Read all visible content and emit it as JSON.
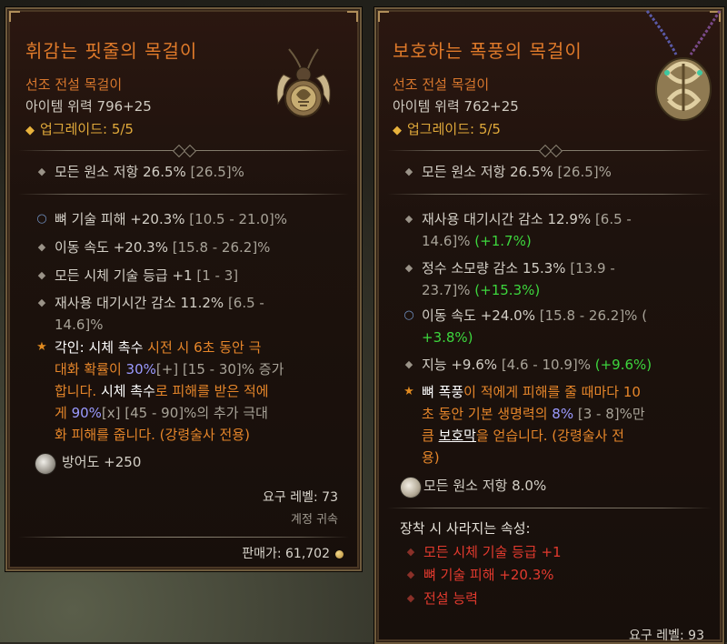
{
  "left": {
    "title": "휘감는 핏줄의 목걸이",
    "subtitle": "선조 전설 목걸이",
    "power": "아이템 위력 796+25",
    "upgrade": "업그레이드: 5/5",
    "implicit": {
      "text": "모든 원소 저항 26.5% ",
      "range": "[26.5]%"
    },
    "affixes": [
      {
        "text": "뼈 기술 피해 +20.3% ",
        "range": "[10.5 - 21.0]%"
      },
      {
        "text": "이동 속도 +20.3% ",
        "range": "[15.8 - 26.2]%"
      },
      {
        "text": "모든 시체 기술 등급 +1 ",
        "range": "[1 - 3]"
      },
      {
        "text": "재사용 대기시간 감소 11.2% ",
        "range": "[6.5 -",
        "range2": "14.6]%"
      }
    ],
    "aspect": {
      "l1a": "각인: ",
      "l1b": "시체 촉수",
      "l1c": " 시전 시 6초 동안 극",
      "l2a": "대화 확률이 ",
      "l2b": "30%",
      "l2c": "[+]",
      "l2d": " [15 - 30]% 증가",
      "l3a": "합니다. ",
      "l3b": "시체 촉수",
      "l3c": "로 피해를 받은 적에",
      "l4a": "게 ",
      "l4b": "90%",
      "l4c": "[x]",
      "l4d": " [45 - 90]%의 추가 극대",
      "l5": "화 피해를 줍니다. (강령술사 전용)"
    },
    "armor": "방어도 +250",
    "req_level": "요구 레벨: 73",
    "account_bound": "계정 귀속",
    "sell_price": "판매가: 61,702"
  },
  "right": {
    "title": "보호하는 폭풍의 목걸이",
    "subtitle": "선조 전설 목걸이",
    "power": "아이템 위력 762+25",
    "upgrade": "업그레이드: 5/5",
    "implicit": {
      "text": "모든 원소 저항 26.5% ",
      "range": "[26.5]%"
    },
    "affixes": [
      {
        "l1": "재사용 대기시간 감소 12.9% ",
        "r1": "[6.5 -",
        "l2r": "14.6]%",
        "diff": "(+1.7%)"
      },
      {
        "l1": "정수 소모량 감소 15.3% ",
        "r1": "[13.9 -",
        "l2r": "23.7]%",
        "diff": "(+15.3%)"
      },
      {
        "l1": "이동 속도 +24.0% ",
        "r1": "[15.8 - 26.2]% (",
        "diff": "+3.8%)"
      },
      {
        "l1": "지능 +9.6% ",
        "r1": "[4.6 - 10.9]% ",
        "diff": "(+9.6%)"
      }
    ],
    "aspect": {
      "l1a": "뼈 폭풍",
      "l1b": "이 적에게 피해를 줄 때마다 10",
      "l2a": "초 동안 기본 생명력의 ",
      "l2b": "8%",
      "l2c": " [3 - 8]%만",
      "l3a": "큼 ",
      "l3b": "보호막",
      "l3c": "을 얻습니다. (강령술사 전",
      "l4": "용)"
    },
    "resist": "모든 원소 저항 8.0%",
    "loss_header": "장착 시 사라지는 속성:",
    "losses": [
      "모든 시체 기술 등급 +1",
      "뼈 기술 피해 +20.3%",
      "전설 능력"
    ],
    "req_level": "요구 레벨: 93"
  },
  "colors": {
    "legendary": "#e07a2a",
    "upgrade": "#e0a93a",
    "gain": "#3dd63d",
    "loss": "#e23a2e"
  }
}
